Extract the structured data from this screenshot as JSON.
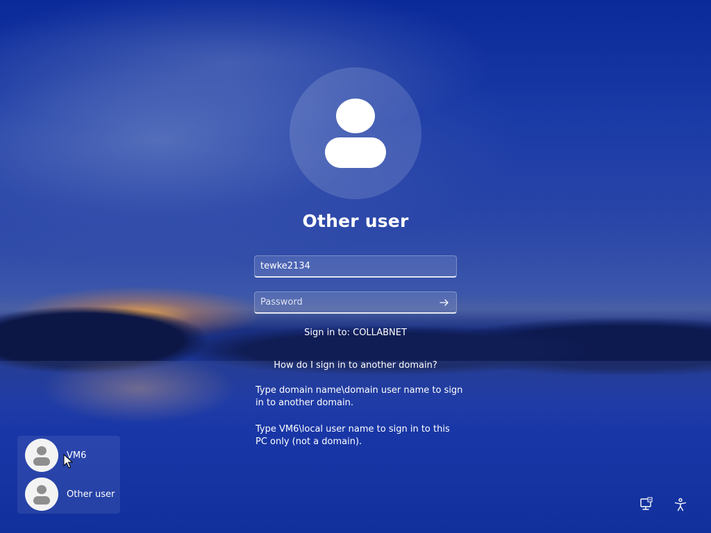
{
  "login": {
    "title": "Other user",
    "username_value": "tewke2134",
    "password_placeholder": "Password",
    "sign_in_to": "Sign in to: COLLABNET",
    "help_link": "How do I sign in to another domain?",
    "help_text_1": "Type domain name\\domain user name to sign in to another domain.",
    "help_text_2": "Type VM6\\local user name to sign in to this PC only (not a domain)."
  },
  "users": [
    {
      "name": "VM6",
      "icon": "user-avatar-icon"
    },
    {
      "name": "Other user",
      "icon": "user-avatar-icon"
    }
  ],
  "tray": {
    "network_icon": "network-icon",
    "accessibility_icon": "accessibility-icon"
  },
  "colors": {
    "sky_top": "#0b2a9a",
    "sky_mid": "#3b56aa",
    "sunset": "#ffaa3c",
    "text": "#ffffff"
  }
}
